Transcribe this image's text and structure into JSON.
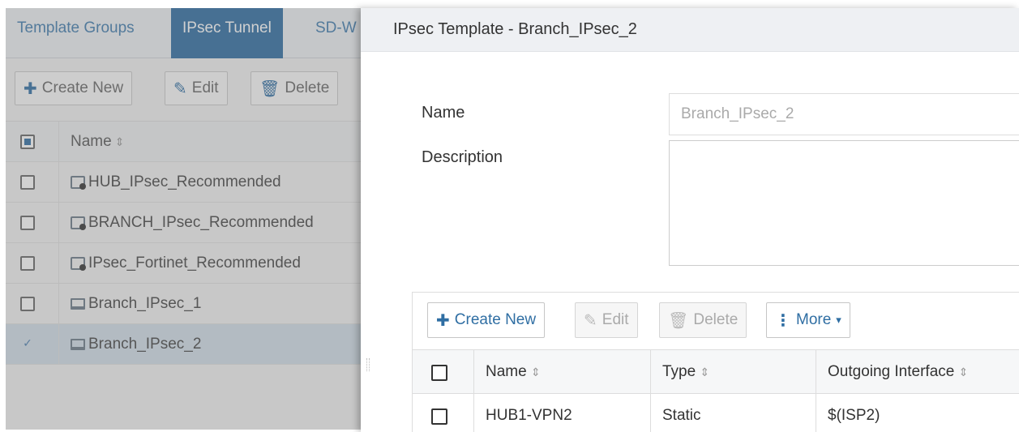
{
  "left_panel": {
    "tabs": [
      {
        "label": "Template Groups"
      },
      {
        "label": "IPsec Tunnel"
      },
      {
        "label": "SD-W"
      }
    ],
    "toolbar": {
      "create_new": "Create New",
      "edit": "Edit",
      "delete": "Delete"
    },
    "table": {
      "header_name": "Name",
      "rows": [
        {
          "name": "HUB_IPsec_Recommended",
          "icon": "template-icon",
          "selected": false
        },
        {
          "name": "BRANCH_IPsec_Recommended",
          "icon": "template-icon",
          "selected": false
        },
        {
          "name": "IPsec_Fortinet_Recommended",
          "icon": "template-icon",
          "selected": false
        },
        {
          "name": "Branch_IPsec_1",
          "icon": "device-icon",
          "selected": false
        },
        {
          "name": "Branch_IPsec_2",
          "icon": "device-icon",
          "selected": true
        }
      ]
    }
  },
  "dialog": {
    "title": "IPsec Template - Branch_IPsec_2",
    "name_label": "Name",
    "name_value": "Branch_IPsec_2",
    "description_label": "Description",
    "description_value": "",
    "toolbar": {
      "create_new": "Create New",
      "edit": "Edit",
      "delete": "Delete",
      "more": "More"
    },
    "table": {
      "headers": {
        "name": "Name",
        "type": "Type",
        "outgoing_interface": "Outgoing Interface"
      },
      "rows": [
        {
          "name": "HUB1-VPN2",
          "type": "Static",
          "outgoing_interface": "$(ISP2)"
        }
      ]
    }
  },
  "colors": {
    "active_tab": "#2d6ca2",
    "link_blue": "#2f6ea3",
    "selected_row": "#d3dfea"
  },
  "icons": {
    "plus": "plus-icon",
    "edit": "edit-icon",
    "delete": "trash-icon",
    "more": "vertical-dots-icon",
    "sort": "sort-icon"
  }
}
